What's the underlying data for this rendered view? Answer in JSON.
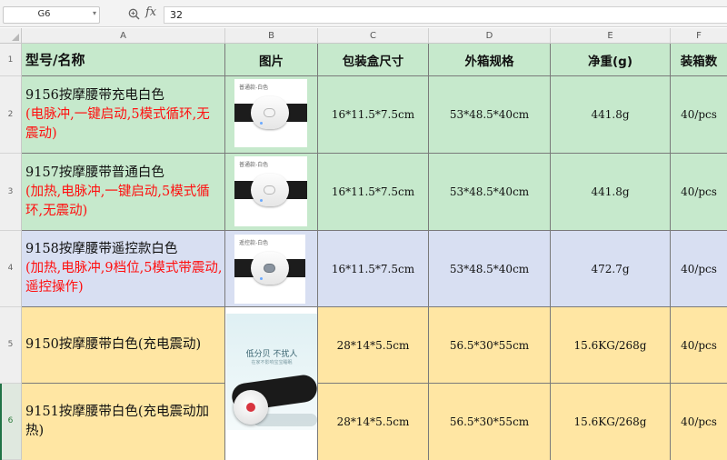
{
  "formula_bar": {
    "cell_ref": "G6",
    "fx_label": "fx",
    "value": "32"
  },
  "columns": [
    "A",
    "B",
    "C",
    "D",
    "E",
    "F"
  ],
  "rows": [
    "1",
    "2",
    "3",
    "4",
    "5",
    "6"
  ],
  "headers": {
    "model": "型号/名称",
    "image": "图片",
    "box_size": "包装盒尺寸",
    "carton_size": "外箱规格",
    "net_weight": "净重(g)",
    "pack_qty": "装箱数"
  },
  "products": [
    {
      "name": "9156按摩腰带充电白色",
      "features": "(电脉冲,一键启动,5模式循环,无震动)",
      "image_caption": "普通款-白色",
      "box_size": "16*11.5*7.5cm",
      "carton_size": "53*48.5*40cm",
      "net_weight": "441.8g",
      "pack_qty": "40/pcs"
    },
    {
      "name": "9157按摩腰带普通白色",
      "features": "(加热,电脉冲,一键启动,5模式循环,无震动)",
      "image_caption": "普通款-白色",
      "box_size": "16*11.5*7.5cm",
      "carton_size": "53*48.5*40cm",
      "net_weight": "441.8g",
      "pack_qty": "40/pcs"
    },
    {
      "name": "9158按摩腰带遥控款白色",
      "features": "(加热,电脉冲,9档位,5模式带震动,遥控操作)",
      "image_caption": "遥控款-白色",
      "box_size": "16*11.5*7.5cm",
      "carton_size": "53*48.5*40cm",
      "net_weight": "472.7g",
      "pack_qty": "40/pcs"
    },
    {
      "name": "9150按摩腰带白色(充电震动)",
      "box_size": "28*14*5.5cm",
      "carton_size": "56.5*30*55cm",
      "net_weight": "15.6KG/268g",
      "pack_qty": "40/pcs"
    },
    {
      "name": "9151按摩腰带白色(充电震动加热)",
      "box_size": "28*14*5.5cm",
      "carton_size": "56.5*30*55cm",
      "net_weight": "15.6KG/268g",
      "pack_qty": "40/pcs"
    }
  ],
  "promo_image": {
    "headline": "低分贝 不扰人",
    "subline": "在家不影响宝宝睡眠"
  },
  "colors": {
    "green_row": "#c6e9cc",
    "blue_row": "#d8dff2",
    "yellow_row": "#ffe6a3",
    "feature_text": "#ff1010"
  }
}
